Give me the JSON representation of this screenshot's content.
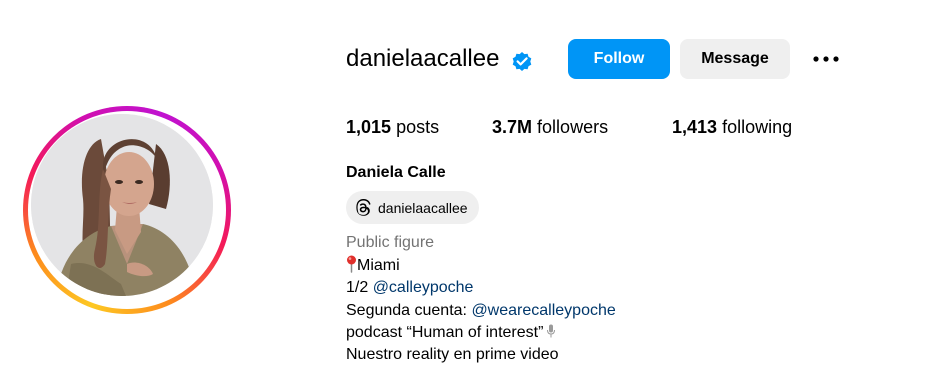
{
  "profile": {
    "username": "danielaacallee",
    "verified_icon": "verified-badge-icon",
    "follow_label": "Follow",
    "message_label": "Message",
    "more_icon": "more-options-icon"
  },
  "stats": {
    "posts_count": "1,015",
    "posts_label": "posts",
    "followers_count": "3.7M",
    "followers_label": "followers",
    "following_count": "1,413",
    "following_label": "following"
  },
  "bio": {
    "full_name": "Daniela Calle",
    "threads_handle": "danielaacallee",
    "threads_icon": "threads-icon",
    "category": "Public figure",
    "city": "Miami",
    "city_icon": "round-pushpin-icon",
    "part_prefix": "1/2 ",
    "part_mention": "@calleypoche",
    "second_prefix": "Segunda cuenta: ",
    "second_mention": "@wearecalleypoche",
    "podcast_text": "podcast “Human of interest”",
    "podcast_icon": "microphone-icon",
    "reality_text": "Nuestro reality en prime video"
  },
  "colors": {
    "follow_button": "#0095f6",
    "message_button": "#efefef",
    "verified_badge": "#0095f6",
    "mention_link": "#00376b",
    "category_text": "#737373",
    "ring_gradient": [
      "#fdc823",
      "#fd8a1d",
      "#f41a58",
      "#d10fb0"
    ]
  }
}
